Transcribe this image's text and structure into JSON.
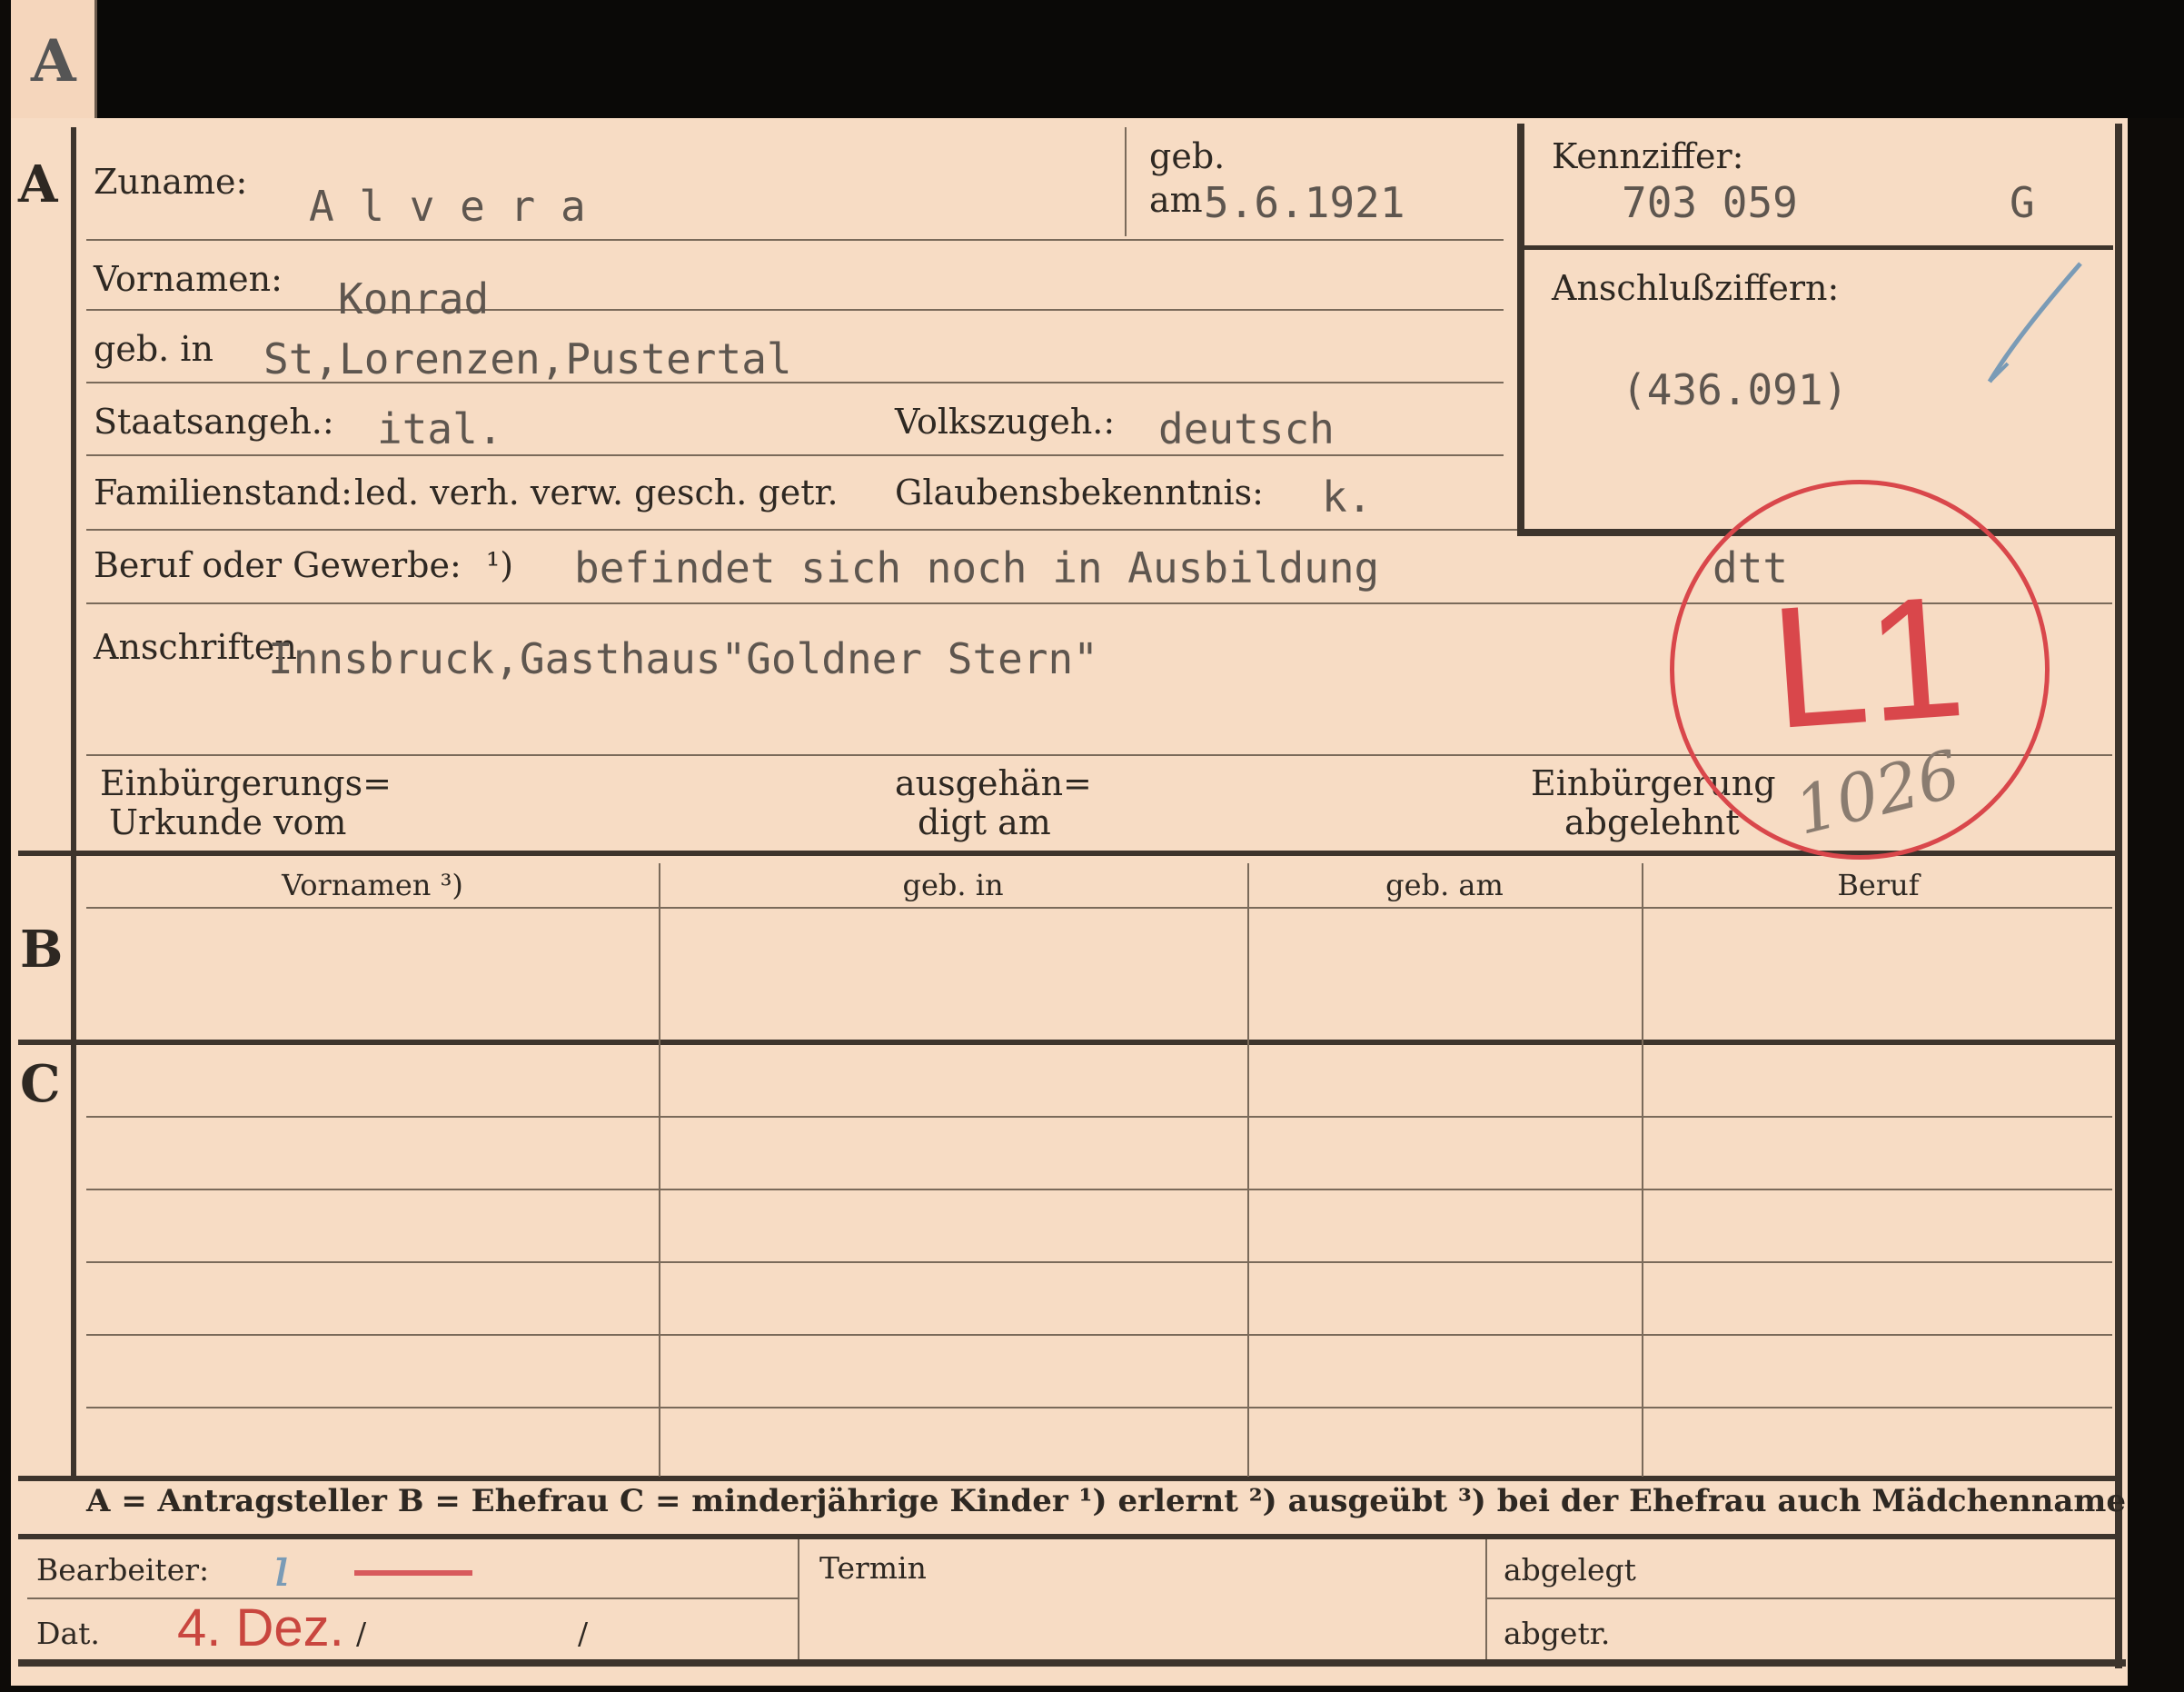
{
  "tab_letter": "A",
  "sections": {
    "a": "A",
    "b": "B",
    "c": "C"
  },
  "header": {
    "surname_label": "Zuname:",
    "surname_value": "A l v e r a",
    "born_label": "geb.",
    "born_on_label": "am",
    "born_on_value": "5.6.1921",
    "id_label": "Kennziffer:",
    "id_value": "703 059",
    "id_suffix": "G"
  },
  "fields": {
    "first_names_label": "Vornamen:",
    "first_names_value": "Konrad",
    "born_in_label": "geb. in",
    "born_in_value": "St,Lorenzen,Pustertal",
    "citizenship_label": "Staatsangeh.:",
    "citizenship_value": "ital.",
    "ethnicity_label": "Volkszugeh.:",
    "ethnicity_value": "deutsch",
    "marital_label": "Familienstand:",
    "marital_options": "led. verh. verw. gesch. getr.",
    "religion_label": "Glaubensbekenntnis:",
    "religion_value": "k.",
    "occupation_label": "Beruf oder Gewerbe:",
    "occupation_note": "¹)",
    "occupation_value": "befindet sich noch in Ausbildung",
    "occupation_extra": "dtt",
    "address_label": "Anschriften",
    "address_value": "Innsbruck,Gasthaus\"Goldner Stern\""
  },
  "connection": {
    "label": "Anschlußziffern:",
    "value": "(436.091)"
  },
  "naturalization": {
    "cert_label_1": "Einbürgerungs=",
    "cert_label_2": "Urkunde vom",
    "issued_label_1": "ausgehän=",
    "issued_label_2": "digt am",
    "rejected_label_1": "Einbürgerung",
    "rejected_label_2": "abgelehnt"
  },
  "stamp": {
    "code": "L1",
    "number": "1026"
  },
  "table": {
    "headers": [
      "Vornamen ³)",
      "geb. in",
      "geb. am",
      "Beruf"
    ]
  },
  "legend": "A = Antragsteller   B = Ehefrau   C = minderjährige Kinder   ¹) erlernt   ²) ausgeübt   ³) bei der Ehefrau auch Mädchenname",
  "footer": {
    "clerk_label": "Bearbeiter:",
    "date_label": "Dat.",
    "date_stamp": "4. Dez.",
    "date_sep_1": "/",
    "date_sep_2": "/",
    "deadline_label": "Termin",
    "filed_label": "abgelegt",
    "separated_label": "abgetr."
  },
  "colors": {
    "card": "#f7dcc4",
    "stamp_red": "#d9474b",
    "ink": "#2e2822",
    "typewriter": "#5e564f"
  }
}
